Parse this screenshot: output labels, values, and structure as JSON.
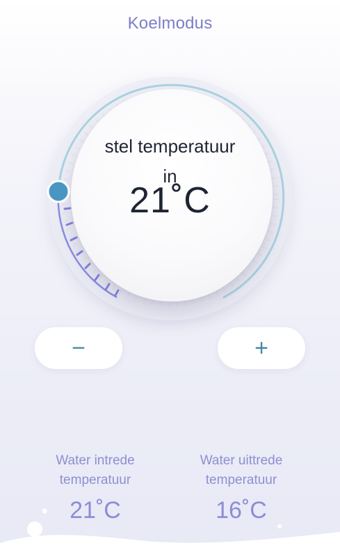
{
  "header": {
    "mode_title": "Koelmodus"
  },
  "dial": {
    "label_line1": "stel temperatuur",
    "label_line2": "in",
    "setpoint": "21˚C",
    "knob_color": "#4a96c2",
    "arc_color": "#a9d3e0",
    "tick_color": "#7f7fe0"
  },
  "controls": {
    "decrease_symbol": "−",
    "increase_symbol": "+"
  },
  "water_inlet": {
    "label_line1": "Water intrede",
    "label_line2": "temperatuur",
    "value": "21˚C"
  },
  "water_outlet": {
    "label_line1": "Water uittrede",
    "label_line2": "temperatuur",
    "value": "16˚C"
  }
}
